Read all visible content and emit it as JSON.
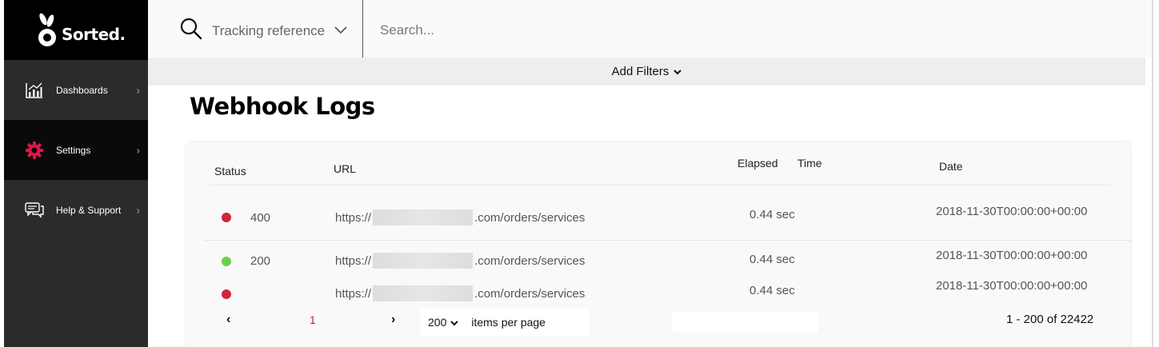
{
  "brand": {
    "name": "Sorted."
  },
  "sidebar": {
    "items": [
      {
        "label": "Dashboards",
        "icon": "chart-icon"
      },
      {
        "label": "Settings",
        "icon": "gear-icon",
        "accent": "#e0144c"
      },
      {
        "label": "Help & Support",
        "icon": "chat-icon"
      }
    ]
  },
  "search": {
    "type_label": "Tracking reference",
    "placeholder": "Search..."
  },
  "filters": {
    "label": "Add Filters"
  },
  "page": {
    "title": "Webhook Logs"
  },
  "table": {
    "headers": {
      "status": "Status",
      "url": "URL",
      "elapsed": "Elapsed",
      "time": "Time",
      "date": "Date"
    },
    "rows": [
      {
        "status_color": "#d0243c",
        "code": "400",
        "url_prefix": "https://",
        "url_suffix": ".com/orders/services",
        "elapsed": "0.44 sec",
        "date": "2018-11-30T00:00:00+00:00"
      },
      {
        "status_color": "#6ccf48",
        "code": "200",
        "url_prefix": "https://",
        "url_suffix": ".com/orders/services",
        "elapsed": "0.44 sec",
        "date": "2018-11-30T00:00:00+00:00"
      },
      {
        "status_color": "#d0243c",
        "code": "",
        "url_prefix": "https://",
        "url_suffix": ".com/orders/services",
        "elapsed": "0.44 sec",
        "date": "2018-11-30T00:00:00+00:00"
      }
    ]
  },
  "pagination": {
    "current_page": "1",
    "page_size": "200",
    "items_per_page_label": "items per page",
    "range_text": "1 - 200 of 22422"
  }
}
